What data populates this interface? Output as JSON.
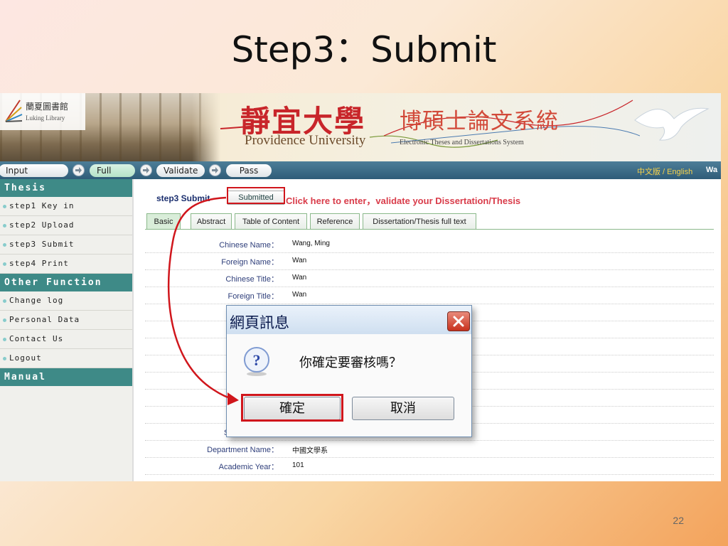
{
  "slide": {
    "title": "Step3：Submit",
    "page_number": "22"
  },
  "banner": {
    "library_name_zh": "蘭夏圖書館",
    "library_name_en": "Luking Library",
    "university_zh": "靜宜大學",
    "university_en": "Providence University",
    "system_zh": "博碩士論文系統",
    "system_en": "Electronic Theses and Dissertations System"
  },
  "nav": {
    "steps": [
      "Input Metadata",
      "Full text",
      "Validate",
      "Pass"
    ],
    "language_link": "中文版 / English",
    "user": "Wa"
  },
  "sidebar": {
    "thesis_header": "Thesis",
    "thesis_items": [
      "step1 Key in",
      "step2 Upload",
      "step3 Submit",
      "step4 Print"
    ],
    "other_header": "Other Function",
    "other_items": [
      "Change log",
      "Personal Data",
      "Contact Us",
      "Logout"
    ],
    "manual_header": "Manual"
  },
  "main": {
    "step_label": "step3 Submit",
    "submitted_button": "Submitted",
    "enter_link": "Click here to enter，validate your Dissertation/Thesis",
    "tabs": [
      "Basic",
      "Abstract",
      "Table of Content",
      "Reference",
      "Dissertation/Thesis full text"
    ],
    "fields": [
      {
        "label": "Chinese Name：",
        "value": "Wang, Ming"
      },
      {
        "label": "Foreign Name：",
        "value": "Wan"
      },
      {
        "label": "Chinese Title：",
        "value": "Wan"
      },
      {
        "label": "Foreign Title：",
        "value": "Wan"
      },
      {
        "label": "",
        "value": ""
      },
      {
        "label": "",
        "value": ""
      },
      {
        "label": "E-",
        "value": ""
      },
      {
        "label": "Adviso",
        "value": ""
      },
      {
        "label": "",
        "value": ""
      },
      {
        "label": "D",
        "value": ""
      },
      {
        "label": "",
        "value": ""
      },
      {
        "label": "School Name：",
        "value": "靜宜大學"
      },
      {
        "label": "Department Name：",
        "value": "中國文學系"
      },
      {
        "label": "Academic Year：",
        "value": "101"
      }
    ]
  },
  "dialog": {
    "title": "網頁訊息",
    "message": "你確定要審核嗎？",
    "ok": "確定",
    "cancel": "取消"
  },
  "colors": {
    "highlight": "#d0161c",
    "nav_bar": "#2f5c78",
    "sidebar_header": "#3e8a87"
  }
}
